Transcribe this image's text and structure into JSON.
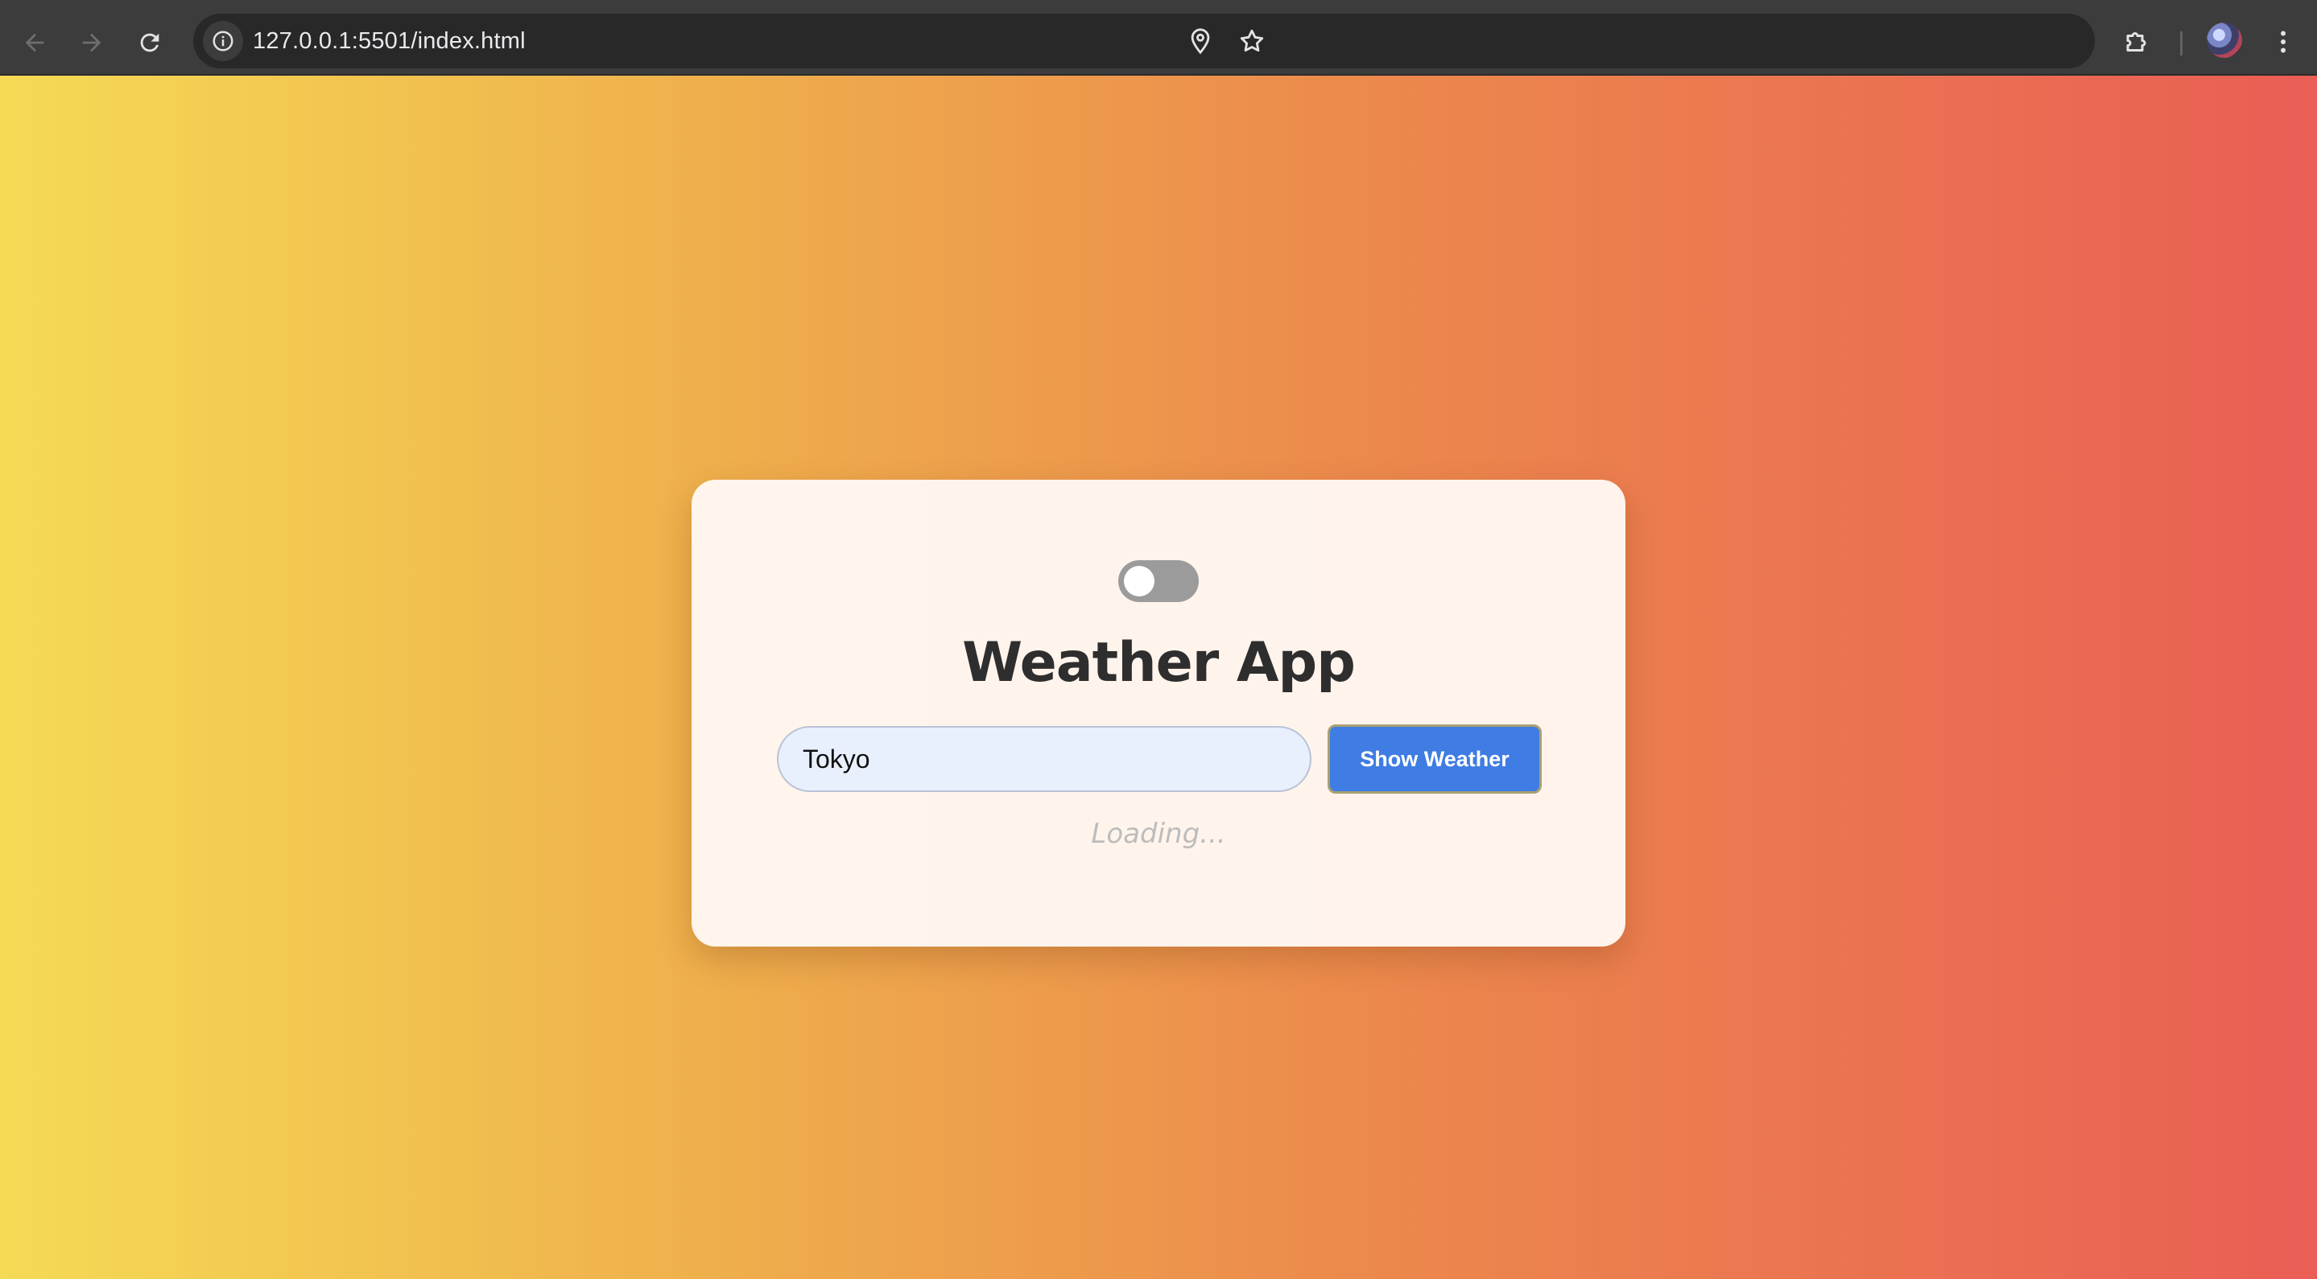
{
  "browser": {
    "url": "127.0.0.1:5501/index.html",
    "icons": {
      "back": "arrow-left-icon",
      "forward": "arrow-right-icon",
      "reload": "reload-icon",
      "site_info": "info-icon",
      "location": "location-pin-icon",
      "bookmark": "star-icon",
      "extensions": "puzzle-icon",
      "menu": "kebab-menu-icon",
      "profile": "avatar"
    }
  },
  "app": {
    "theme_toggle": {
      "on": false
    },
    "title": "Weather App",
    "city_input": {
      "value": "Tokyo",
      "placeholder": ""
    },
    "show_button_label": "Show Weather",
    "status_text": "Loading..."
  },
  "colors": {
    "gradient_start": "#f5da55",
    "gradient_end": "#ea5e55",
    "button": "#3f7ce3",
    "title": "#2e2e2e"
  }
}
